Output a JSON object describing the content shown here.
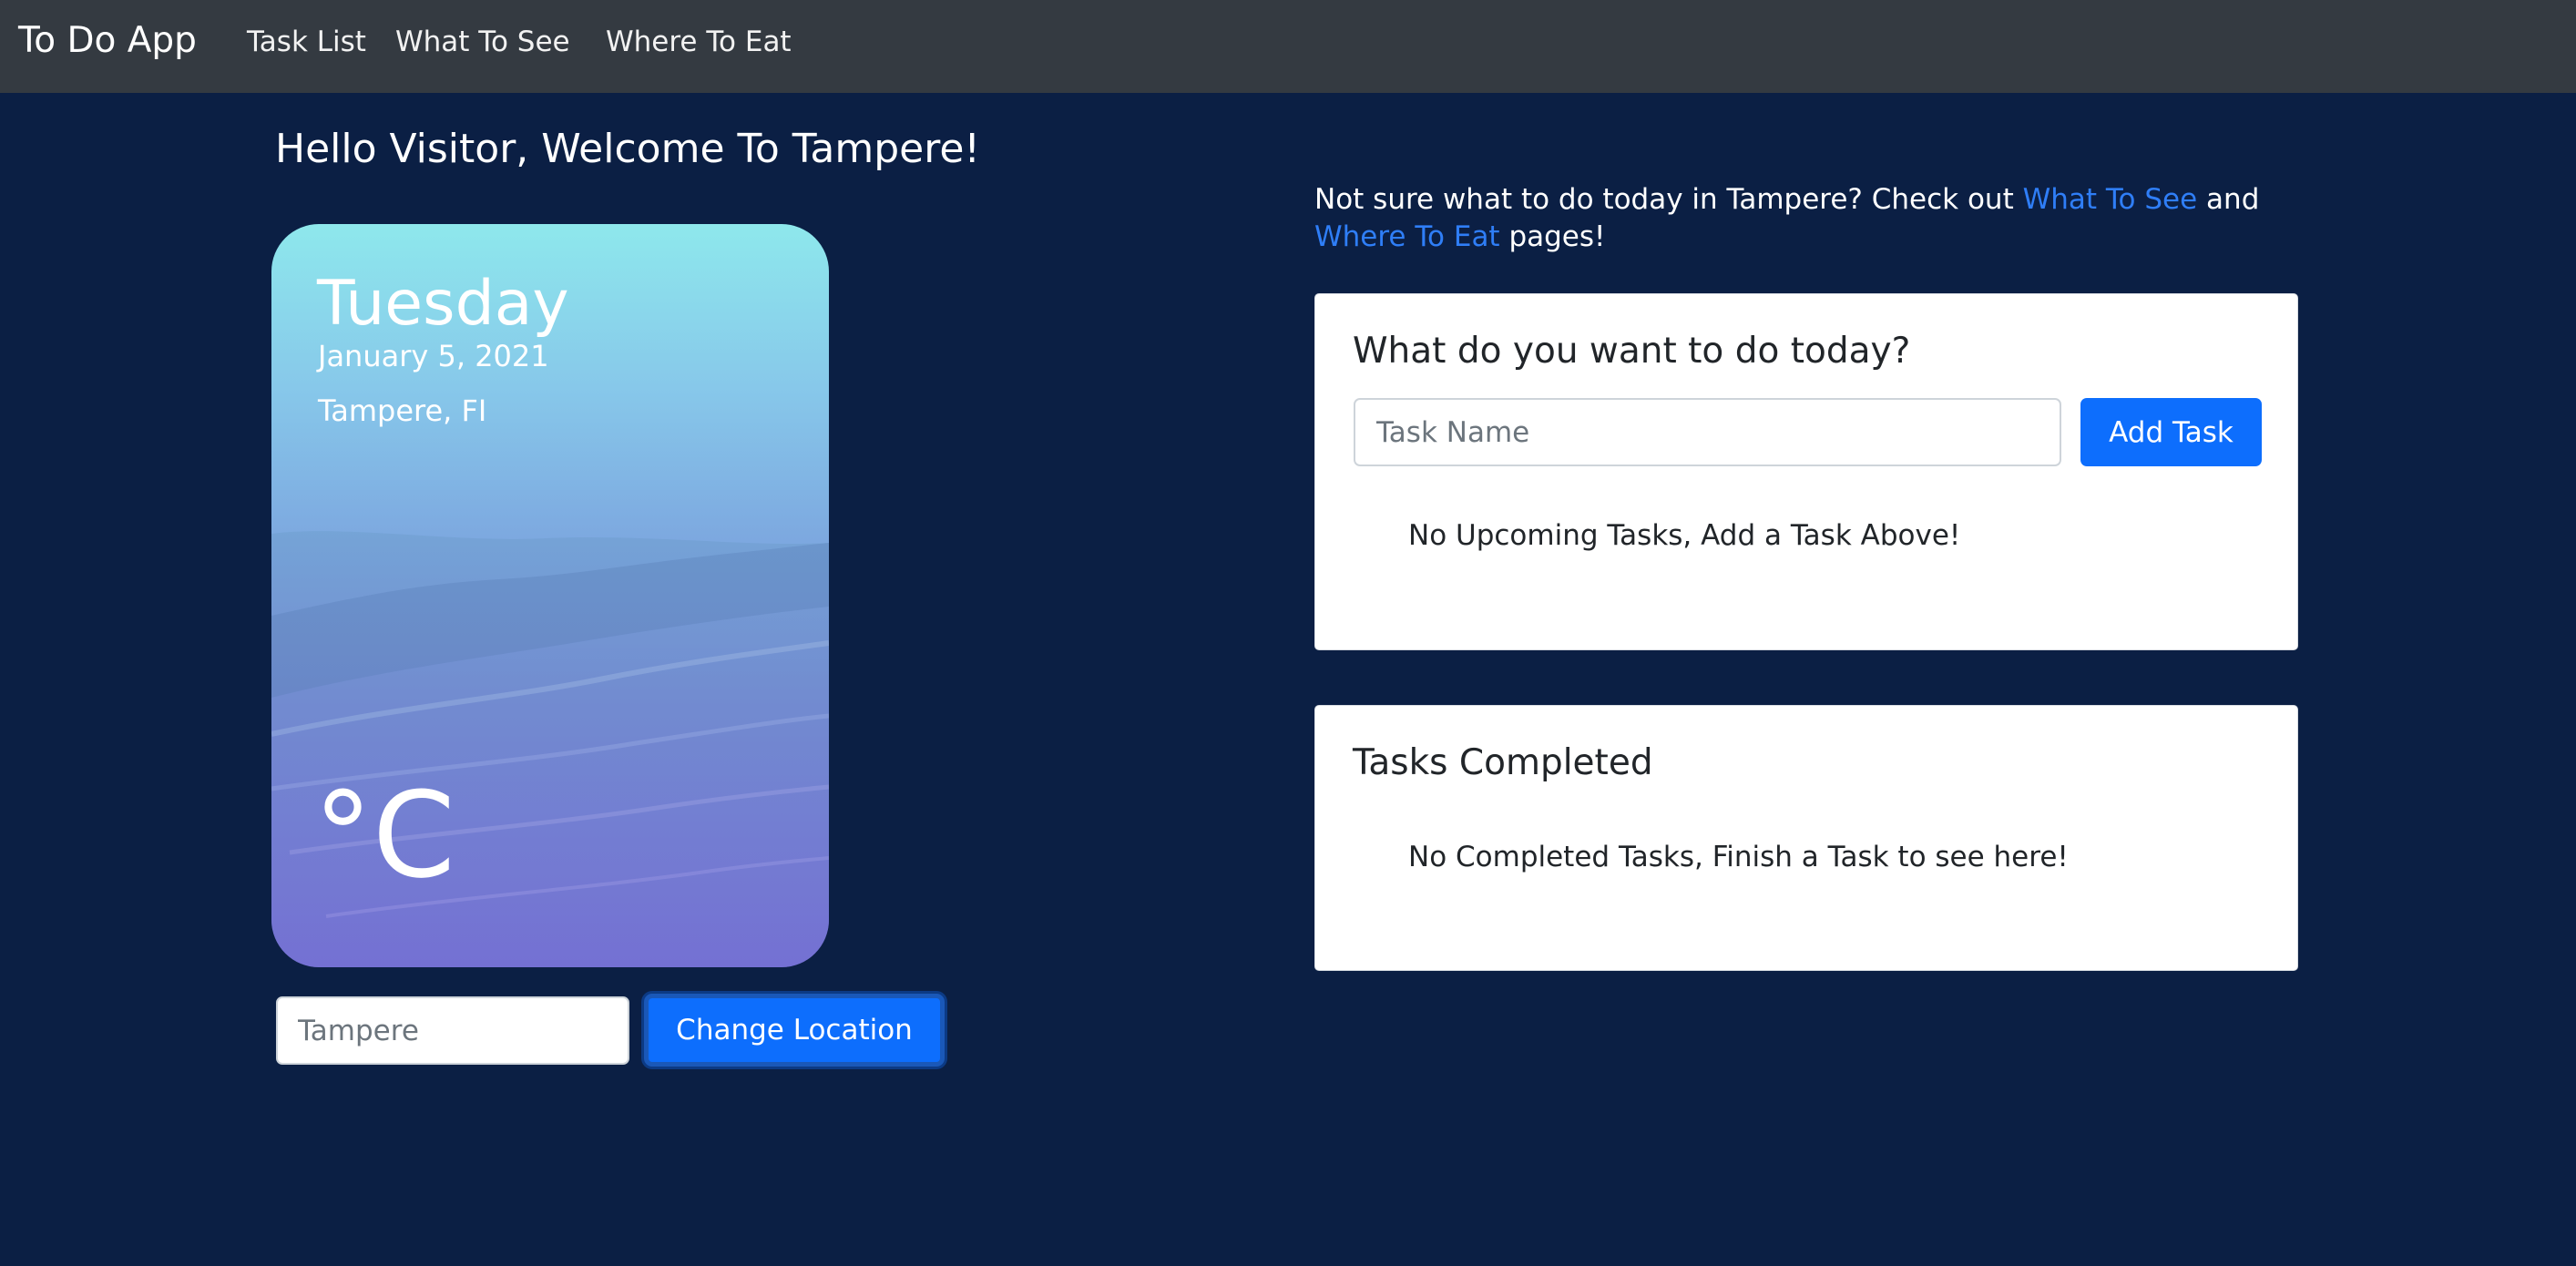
{
  "navbar": {
    "brand": "To Do App",
    "links": [
      "Task List",
      "What To See",
      "Where To Eat"
    ]
  },
  "welcome": "Hello Visitor, Welcome To Tampere!",
  "weather": {
    "day": "Tuesday",
    "date": "January 5, 2021",
    "location": "Tampere, FI",
    "temperature": "°C"
  },
  "location_form": {
    "placeholder": "Tampere",
    "button_label": "Change Location"
  },
  "intro": {
    "text_before": "Not sure what to do today in Tampere? Check out ",
    "link_see": "What To See",
    "text_mid": " and ",
    "link_eat": "Where To Eat",
    "text_after": " pages!"
  },
  "todo_card": {
    "title": "What do you want to do today?",
    "input_placeholder": "Task Name",
    "add_button": "Add Task",
    "empty_message": "No Upcoming Tasks, Add a Task Above!"
  },
  "completed_card": {
    "title": "Tasks Completed",
    "empty_message": "No Completed Tasks, Finish a Task to see here!"
  },
  "colors": {
    "background": "#0b1f44",
    "navbar": "#343a41",
    "primary": "#0d6efd",
    "link": "#2f7ef7"
  }
}
